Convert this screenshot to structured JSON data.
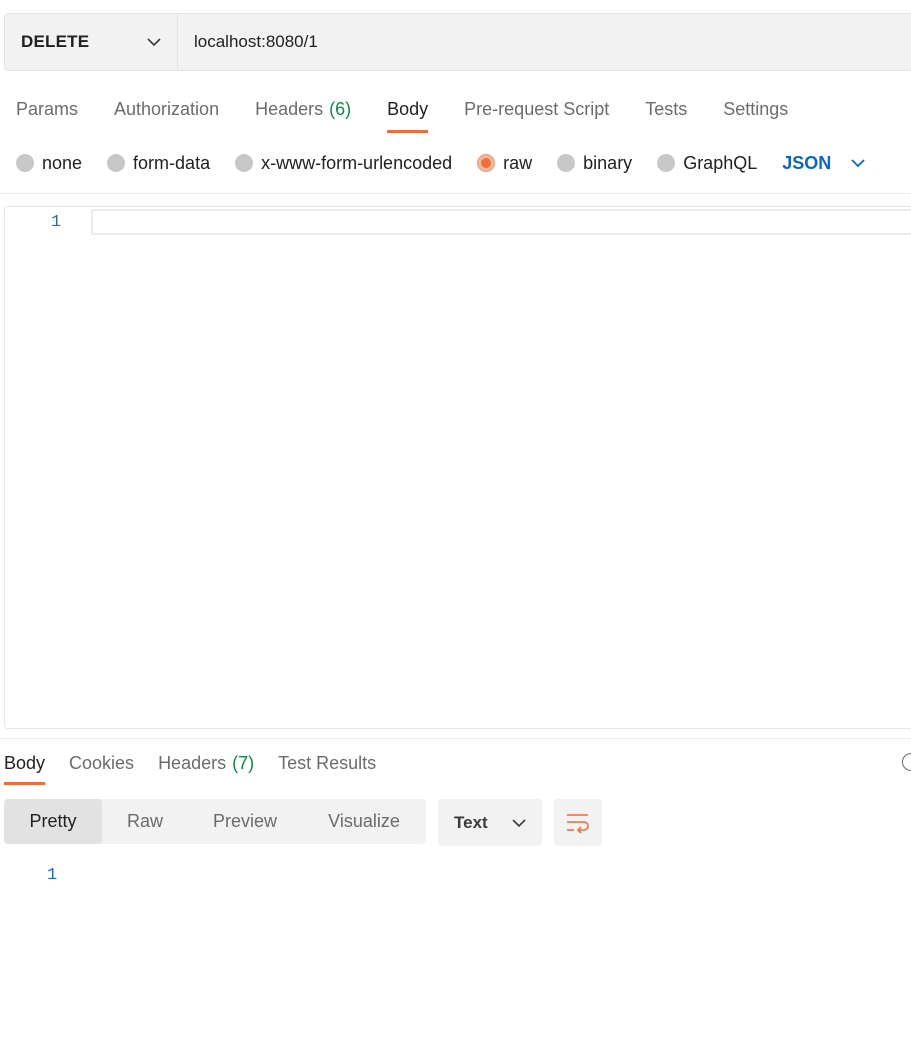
{
  "request": {
    "method": "DELETE",
    "url": "localhost:8080/1"
  },
  "request_tabs": [
    {
      "label": "Params",
      "count": ""
    },
    {
      "label": "Authorization",
      "count": ""
    },
    {
      "label": "Headers",
      "count": "(6)"
    },
    {
      "label": "Body",
      "count": ""
    },
    {
      "label": "Pre-request Script",
      "count": ""
    },
    {
      "label": "Tests",
      "count": ""
    },
    {
      "label": "Settings",
      "count": ""
    }
  ],
  "active_request_tab": "Body",
  "body_types": [
    {
      "label": "none",
      "checked": false
    },
    {
      "label": "form-data",
      "checked": false
    },
    {
      "label": "x-www-form-urlencoded",
      "checked": false
    },
    {
      "label": "raw",
      "checked": true
    },
    {
      "label": "binary",
      "checked": false
    },
    {
      "label": "GraphQL",
      "checked": false
    }
  ],
  "raw_format": "JSON",
  "editor": {
    "line_number": "1",
    "content": ""
  },
  "response_tabs": [
    {
      "label": "Body",
      "count": ""
    },
    {
      "label": "Cookies",
      "count": ""
    },
    {
      "label": "Headers",
      "count": "(7)"
    },
    {
      "label": "Test Results",
      "count": ""
    }
  ],
  "active_response_tab": "Body",
  "view_modes": [
    "Pretty",
    "Raw",
    "Preview",
    "Visualize"
  ],
  "active_view_mode": "Pretty",
  "response_format": "Text",
  "response": {
    "line_number": "1"
  },
  "icons": {
    "method_dropdown": "chevron-down-icon",
    "format_dropdown": "chevron-down-icon",
    "wrap": "wrap-lines-icon",
    "globe": "globe-icon"
  },
  "colors": {
    "accent": "#f26b3a",
    "count_green": "#0c8a44",
    "json_blue": "#0b66c3",
    "line_number_blue": "#1e6fb0"
  }
}
